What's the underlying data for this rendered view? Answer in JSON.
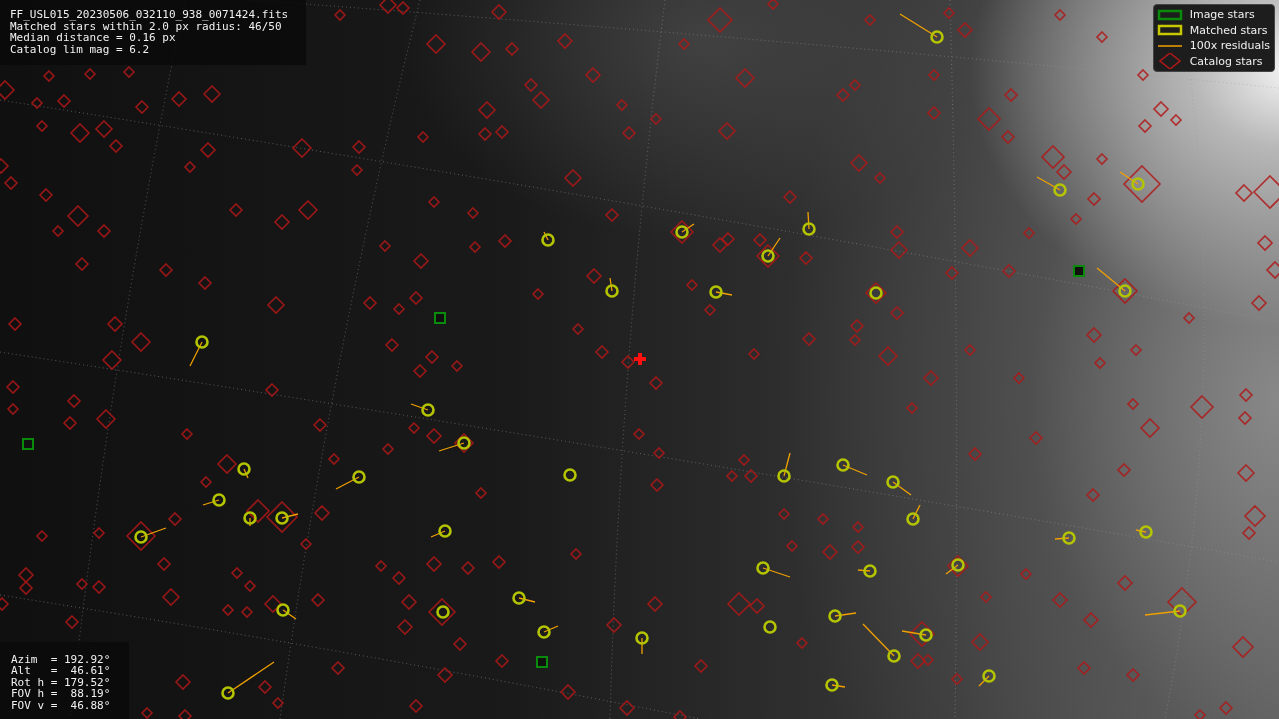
{
  "info_panel": {
    "lines": [
      "FF_USL015_20230506_032110_938_0071424.fits",
      "Matched stars within 2.0 px radius: 46/50",
      "Median distance = 0.16 px",
      "Catalog lim mag = 6.2"
    ]
  },
  "legend": {
    "items": [
      {
        "kind": "image",
        "label": "Image stars"
      },
      {
        "kind": "matched",
        "label": "Matched stars"
      },
      {
        "kind": "residual",
        "label": "100x residuals"
      },
      {
        "kind": "catalog",
        "label": "Catalog stars"
      }
    ]
  },
  "pointing_panel": {
    "lines": [
      "Azim  = 192.92°",
      "Alt   =  46.61°",
      "Rot h = 179.52°",
      "FOV h =  88.19°",
      "FOV v =  46.88°"
    ]
  }
}
